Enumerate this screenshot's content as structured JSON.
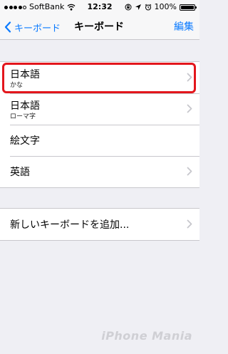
{
  "status_bar": {
    "carrier": "SoftBank",
    "time": "12:32",
    "battery": "100%"
  },
  "nav": {
    "back_label": "キーボード",
    "title": "キーボード",
    "edit_label": "編集"
  },
  "keyboards": [
    {
      "name": "日本語",
      "sub": "かな",
      "has_chevron": true,
      "highlighted": true
    },
    {
      "name": "日本語",
      "sub": "ローマ字",
      "has_chevron": true
    },
    {
      "name": "絵文字",
      "sub": "",
      "has_chevron": false
    },
    {
      "name": "英語",
      "sub": "",
      "has_chevron": true
    }
  ],
  "add_keyboard": {
    "label": "新しいキーボードを追加..."
  },
  "watermark": "iPhone Mania",
  "colors": {
    "accent": "#0a7aff",
    "highlight": "#e3161c",
    "background": "#efeff4"
  }
}
